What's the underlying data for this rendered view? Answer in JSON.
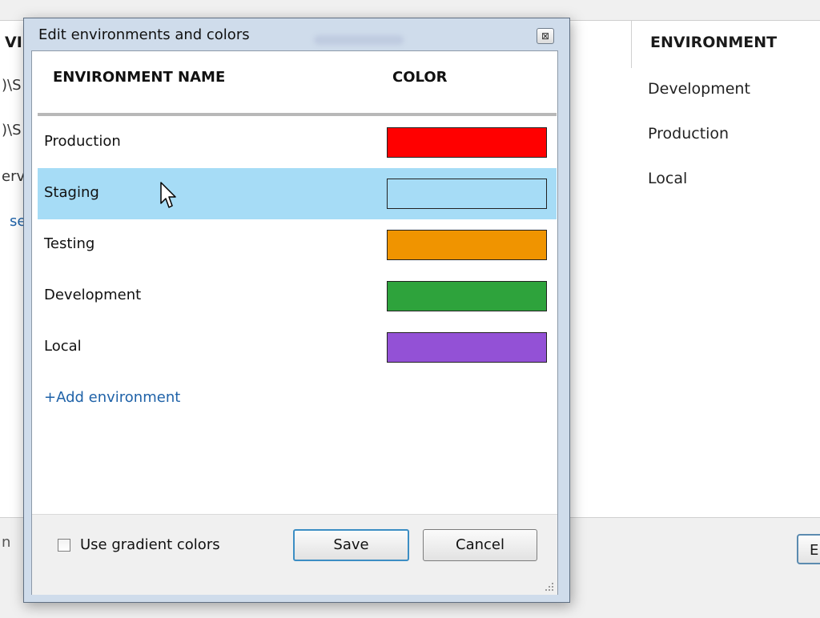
{
  "background_app": {
    "header": {
      "left_fragment": "VI",
      "environment_header": "ENVIRONMENT"
    },
    "left_cells": [
      ")\\S",
      ")\\S",
      "erv",
      "se"
    ],
    "environment_cells": [
      "Development",
      "Production",
      "Local"
    ],
    "footer_fragment": "n",
    "edge_button_label": "E"
  },
  "dialog": {
    "title": "Edit environments and colors",
    "close_glyph": "⊠",
    "columns": {
      "name": "ENVIRONMENT NAME",
      "color": "COLOR"
    },
    "environments": [
      {
        "name": "Production",
        "color": "#ff0000"
      },
      {
        "name": "Staging",
        "color": "#a6dcf6"
      },
      {
        "name": "Testing",
        "color": "#f09400"
      },
      {
        "name": "Development",
        "color": "#2ea33c"
      },
      {
        "name": "Local",
        "color": "#9351d6"
      }
    ],
    "selected_index": 1,
    "add_link": "+Add environment",
    "footer": {
      "gradient_label": "Use gradient colors",
      "gradient_checked": false,
      "save_label": "Save",
      "cancel_label": "Cancel"
    }
  }
}
